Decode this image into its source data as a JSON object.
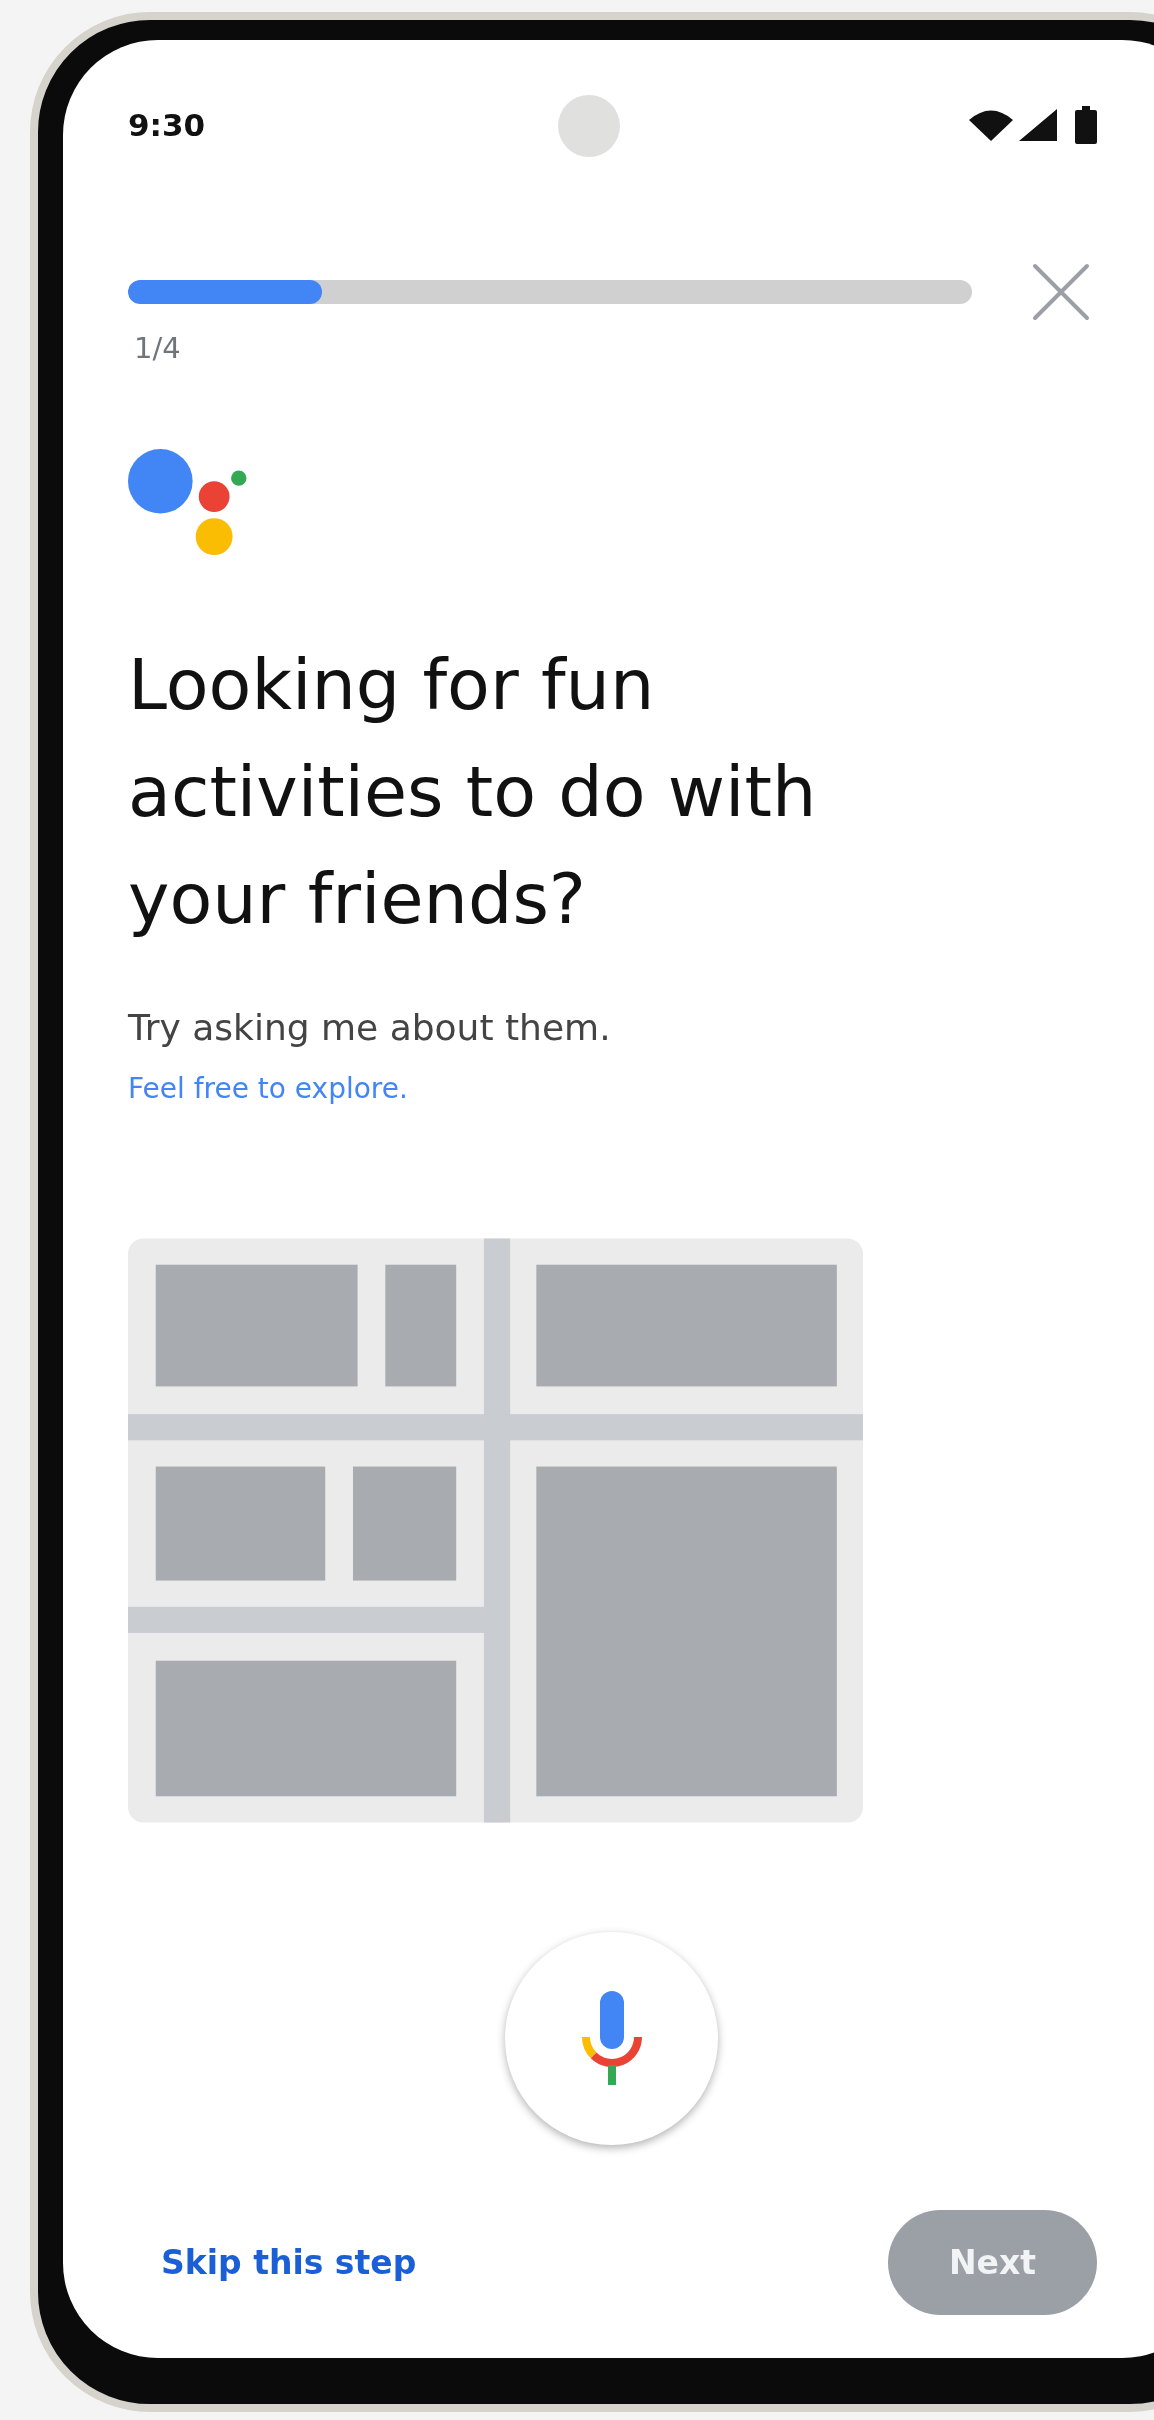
{
  "status_bar": {
    "time": "9:30"
  },
  "progress": {
    "level": 0.23,
    "step": "1/4"
  },
  "headline": "Looking for fun activities to do with your friends?",
  "subtitle": "Try asking me about them.",
  "link": "Feel free to explore.",
  "footer": {
    "skip": "Skip this step",
    "next": {
      "label": "Next",
      "disabled": true
    }
  }
}
